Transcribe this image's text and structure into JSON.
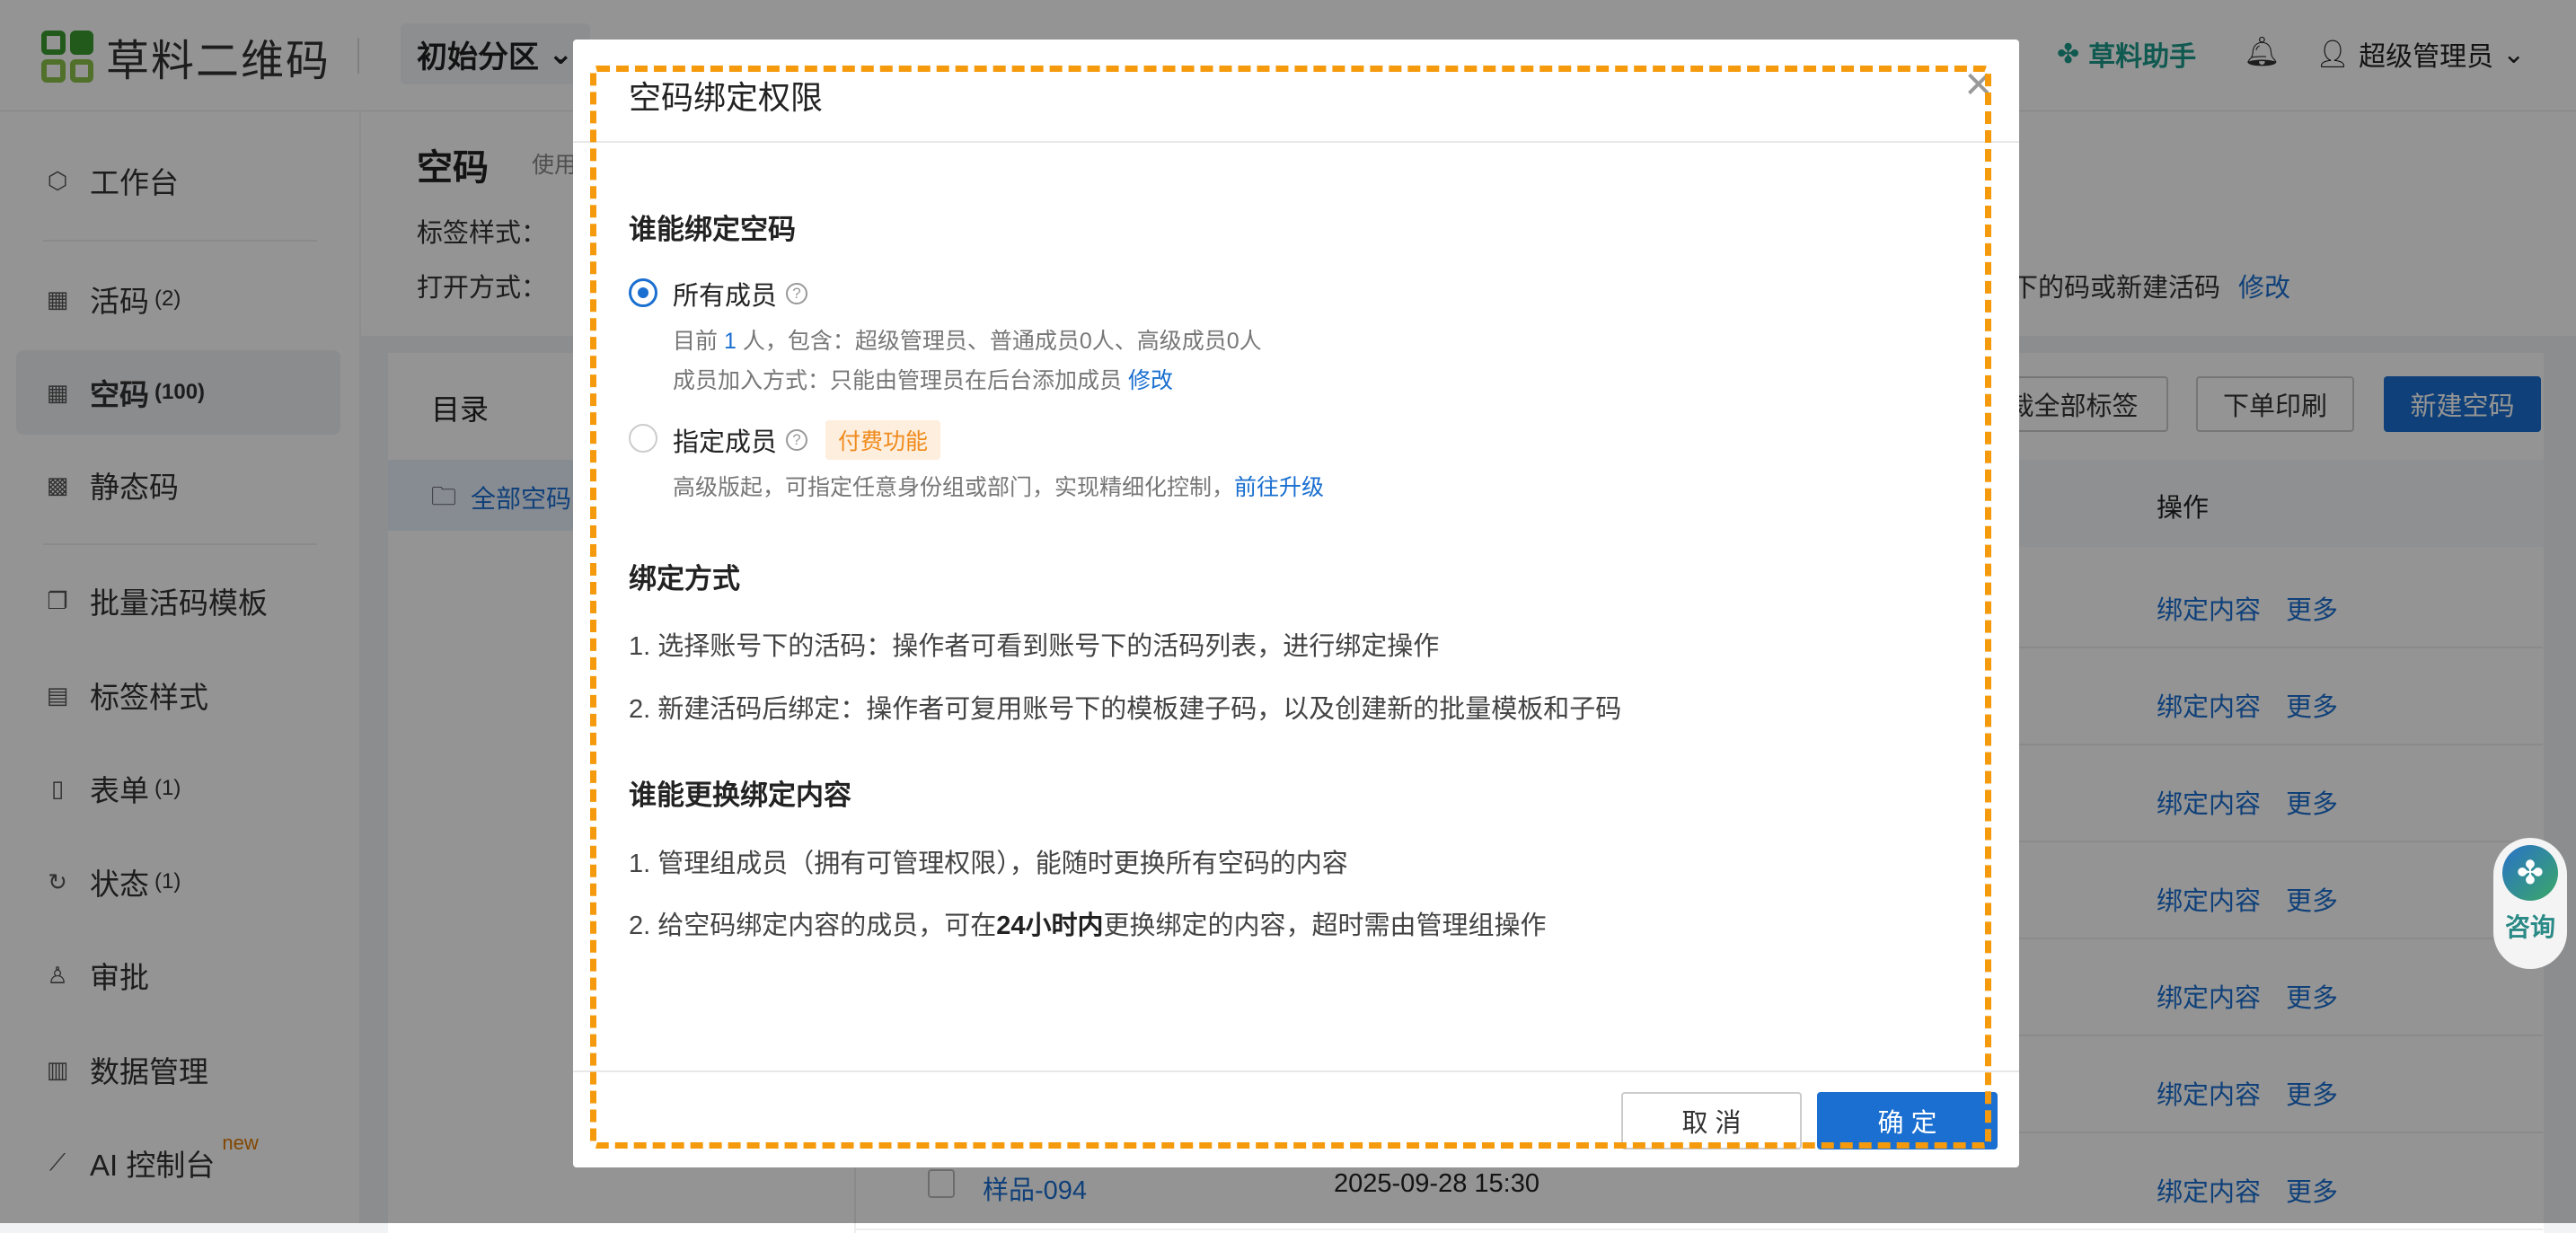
{
  "topbar": {
    "brand": "草料二维码",
    "partition": "初始分区",
    "assistant": "草料助手",
    "user": "超级管理员"
  },
  "sidebar": {
    "items": [
      {
        "label": "工作台",
        "count": ""
      },
      {
        "label": "活码",
        "count": "(2)"
      },
      {
        "label": "空码",
        "count": "(100)"
      },
      {
        "label": "静态码",
        "count": ""
      },
      {
        "label": "批量活码模板",
        "count": ""
      },
      {
        "label": "标签样式",
        "count": ""
      },
      {
        "label": "表单",
        "count": "(1)"
      },
      {
        "label": "状态",
        "count": "(1)"
      },
      {
        "label": "审批",
        "count": ""
      },
      {
        "label": "数据管理",
        "count": ""
      },
      {
        "label": "AI 控制台",
        "count": "",
        "badge": "new"
      }
    ]
  },
  "page": {
    "title": "空码",
    "subtitle": "使用",
    "label_style": "标签样式：",
    "open_mode": "打开方式：",
    "open_mode_tail": "下的码或新建活码",
    "modify": "修改"
  },
  "card": {
    "catalog": "目录",
    "folder": "全部空码",
    "btn_tags": "裁全部标签",
    "btn_print": "下单印刷",
    "btn_new": "新建空码",
    "col_ops": "操作"
  },
  "table": {
    "action_bind": "绑定内容",
    "action_more": "更多",
    "last_row": {
      "name": "样品-094",
      "date": "2025-09-28 15:30"
    }
  },
  "consult": "咨询",
  "modal": {
    "title": "空码绑定权限",
    "s1_title": "谁能绑定空码",
    "opt_all": "所有成员",
    "opt_all_line1_a": "目前",
    "opt_all_count": "1",
    "opt_all_line1_b": "人，包含：超级管理员、普通成员0人、高级成员0人",
    "opt_all_line2": "成员加入方式：只能由管理员在后台添加成员",
    "opt_all_modify": "修改",
    "opt_spec": "指定成员",
    "paid_badge": "付费功能",
    "opt_spec_line": "高级版起，可指定任意身份组或部门，实现精细化控制，",
    "upgrade": "前往升级",
    "s2_title": "绑定方式",
    "s2_p1": "1. 选择账号下的活码：操作者可看到账号下的活码列表，进行绑定操作",
    "s2_p2": "2. 新建活码后绑定：操作者可复用账号下的模板建子码，以及创建新的批量模板和子码",
    "s3_title": "谁能更换绑定内容",
    "s3_p1": "1. 管理组成员（拥有可管理权限），能随时更换所有空码的内容",
    "s3_p2_a": "2. 给空码绑定内容的成员，可在",
    "s3_p2_b": "24小时内",
    "s3_p2_c": "更换绑定的内容，超时需由管理组操作",
    "cancel": "取 消",
    "ok": "确 定"
  },
  "colors": {
    "primary": "#1a6fd0",
    "annotation": "#f59a0c"
  }
}
